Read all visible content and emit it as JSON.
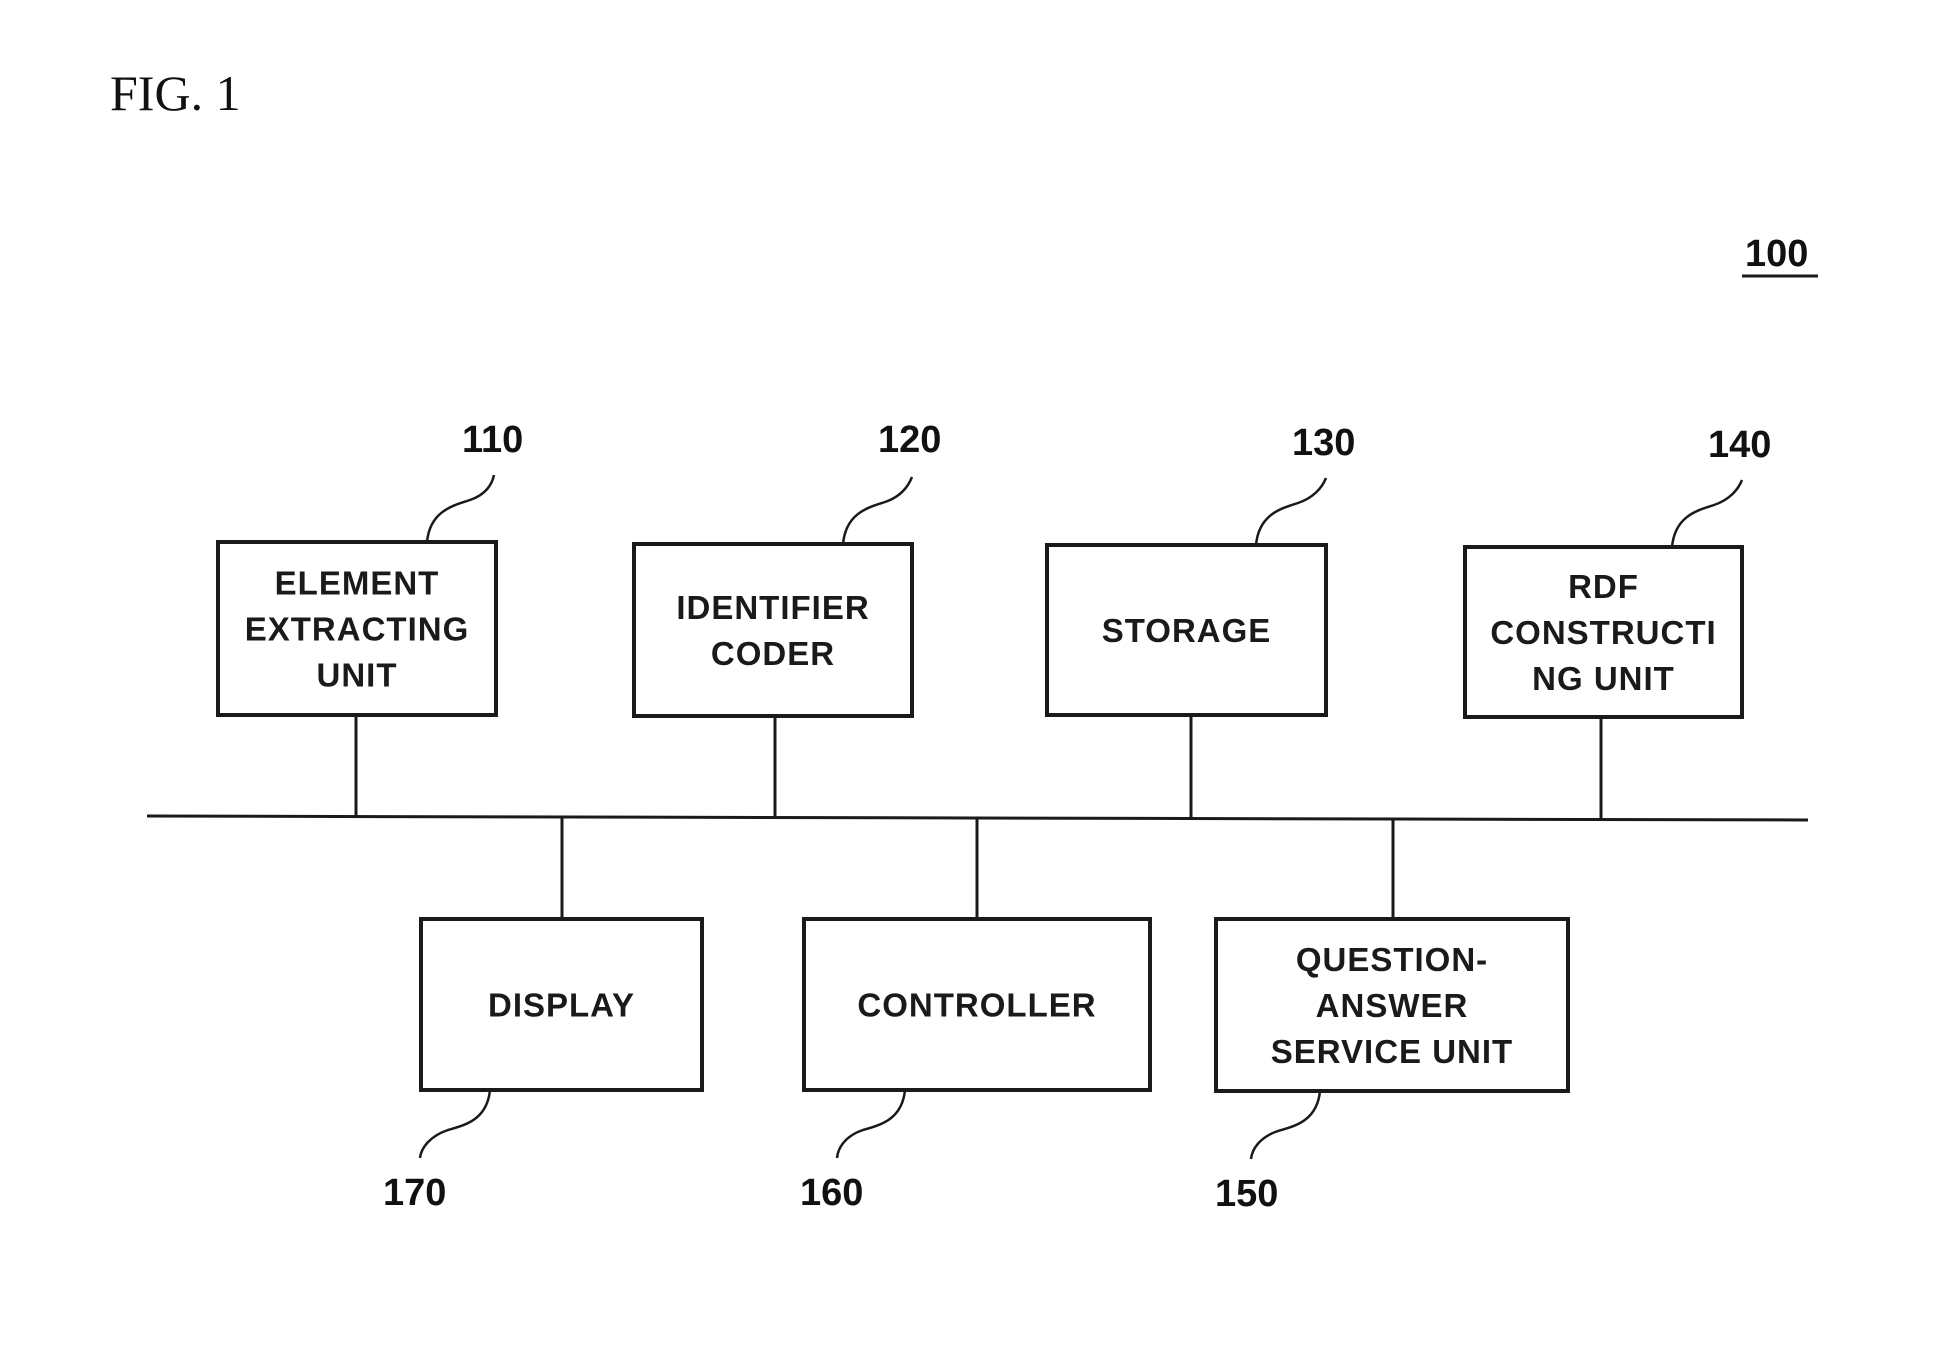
{
  "figure": {
    "title": "FIG. 1",
    "system_ref": "100"
  },
  "blocks": [
    {
      "id": "110",
      "lines": [
        "ELEMENT",
        "EXTRACTING",
        "UNIT"
      ],
      "row": "top"
    },
    {
      "id": "120",
      "lines": [
        "IDENTIFIER",
        "CODER"
      ],
      "row": "top"
    },
    {
      "id": "130",
      "lines": [
        "STORAGE"
      ],
      "row": "top"
    },
    {
      "id": "140",
      "lines": [
        "RDF",
        "CONSTRUCTI",
        "NG UNIT"
      ],
      "row": "top"
    },
    {
      "id": "170",
      "lines": [
        "DISPLAY"
      ],
      "row": "bottom"
    },
    {
      "id": "160",
      "lines": [
        "CONTROLLER"
      ],
      "row": "bottom"
    },
    {
      "id": "150",
      "lines": [
        "QUESTION-",
        "ANSWER",
        "SERVICE UNIT"
      ],
      "row": "bottom"
    }
  ],
  "connections": "all blocks connected to a shared bus"
}
